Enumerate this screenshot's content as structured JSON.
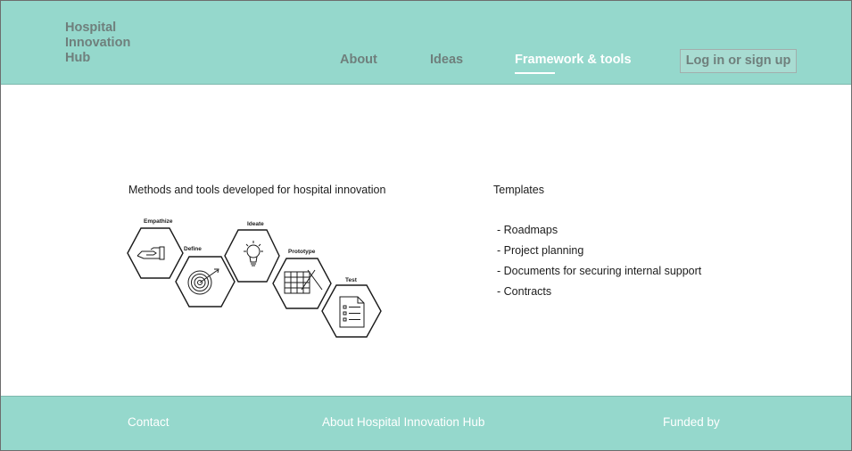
{
  "header": {
    "logo": "Hospital\nInnovation\nHub",
    "nav": [
      {
        "label": "About"
      },
      {
        "label": "Ideas"
      },
      {
        "label": "Framework & tools"
      }
    ],
    "login_label": "Log in or sign up"
  },
  "main": {
    "methods_title": "Methods and tools developed for hospital innovation",
    "diagram_steps": [
      "Empathize",
      "Define",
      "Ideate",
      "Prototype",
      "Test"
    ],
    "templates_title": "Templates",
    "templates": [
      "- Roadmaps",
      "- Project planning",
      "- Documents for securing internal support",
      "- Contracts"
    ]
  },
  "footer": {
    "contact": "Contact",
    "about": "About Hospital Innovation Hub",
    "funded": "Funded by"
  },
  "colors": {
    "accent": "#95d8cc",
    "nav_text": "#6f7f7c",
    "active_nav": "#ffffff"
  }
}
